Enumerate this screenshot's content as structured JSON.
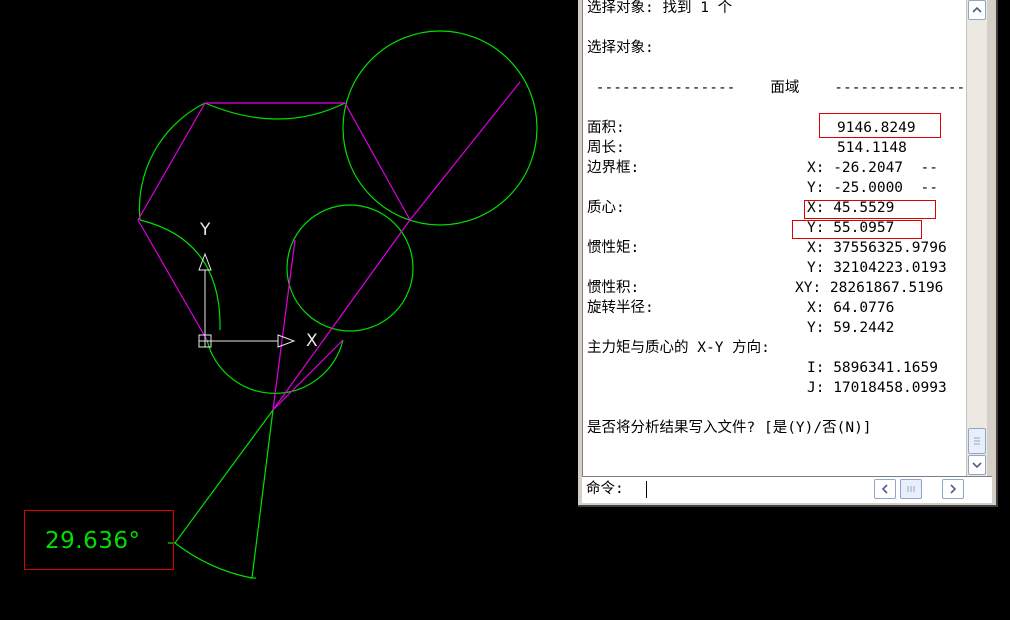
{
  "drawing": {
    "angle_dimension": "29.636°",
    "ucs_y_label": "Y",
    "ucs_x_label": "X",
    "colors": {
      "background": "#000000",
      "geometry": "#00e000",
      "construction": "#e000e0",
      "ucs": "#e8e8e8",
      "highlight": "#e00000"
    }
  },
  "command_window": {
    "lines": {
      "select_found": "选择对象: 找到 1 个",
      "select_prompt": "选择对象:",
      "section_header": " ----------------    面域    ----------------",
      "area_label": "面积:",
      "perimeter_label": "周长:",
      "bbox_label": "边界框:",
      "centroid_label": "质心:",
      "moi_label": "惯性矩:",
      "poi_label": "惯性积:",
      "gyration_label": "旋转半径:",
      "principal_label": "主力矩与质心的 X-Y 方向:",
      "write_prompt": "是否将分析结果写入文件? [是(Y)/否(N)]"
    },
    "values": {
      "area": "9146.8249",
      "perimeter": "514.1148",
      "bbox_x": "X: -26.2047  --",
      "bbox_y": "Y: -25.0000  --",
      "centroid_x": "X: 45.5529",
      "centroid_y": "Y: 55.0957",
      "moi_x": "X: 37556325.9796",
      "moi_y": "Y: 32104223.0193",
      "poi_xy": "XY: 28261867.5196",
      "gyration_x": "X: 64.0776",
      "gyration_y": "Y: 59.2442",
      "principal_i": "I: 5896341.1659",
      "principal_j": "J: 17018458.0993"
    },
    "input_prompt": "命令:",
    "icons": {
      "scroll_up": "chevron-up-icon",
      "scroll_down": "chevron-down-icon",
      "scroll_left": "chevron-left-icon",
      "scroll_right": "chevron-right-icon"
    }
  }
}
